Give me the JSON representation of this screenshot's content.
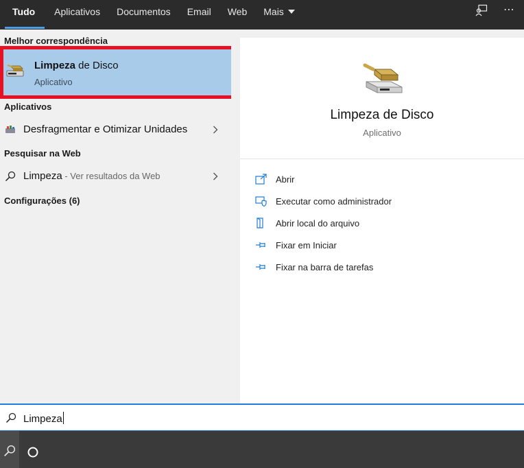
{
  "tabs": [
    {
      "label": "Tudo"
    },
    {
      "label": "Aplicativos"
    },
    {
      "label": "Documentos"
    },
    {
      "label": "Email"
    },
    {
      "label": "Web"
    },
    {
      "label": "Mais"
    }
  ],
  "top_icons": {
    "feedback": "feedback-icon",
    "more": "more-icon",
    "more_glyph": "⋯"
  },
  "left": {
    "best_match_header": "Melhor correspondência",
    "best_match": {
      "title_bold": "Limpeza",
      "title_rest": " de Disco",
      "subtitle": "Aplicativo",
      "icon": "disk-cleanup-icon"
    },
    "apps_header": "Aplicativos",
    "apps": [
      {
        "label": "Desfragmentar e Otimizar Unidades",
        "icon": "defrag-icon"
      }
    ],
    "web_header": "Pesquisar na Web",
    "web": {
      "query": "Limpeza",
      "hint": " - Ver resultados da Web",
      "icon": "search-icon"
    },
    "settings_header": "Configurações (6)"
  },
  "detail": {
    "title": "Limpeza de Disco",
    "subtitle": "Aplicativo",
    "actions": [
      {
        "label": "Abrir",
        "icon": "open-icon"
      },
      {
        "label": "Executar como administrador",
        "icon": "shield-icon"
      },
      {
        "label": "Abrir local do arquivo",
        "icon": "file-location-icon"
      },
      {
        "label": "Fixar em Iniciar",
        "icon": "pin-icon"
      },
      {
        "label": "Fixar na barra de tarefas",
        "icon": "pin-icon"
      }
    ]
  },
  "search": {
    "value": "Limpeza"
  },
  "colors": {
    "accent": "#1e7dd6",
    "highlight": "#a9cbea",
    "selection_border": "#e81123",
    "tab_underline": "#4c9ee6"
  }
}
